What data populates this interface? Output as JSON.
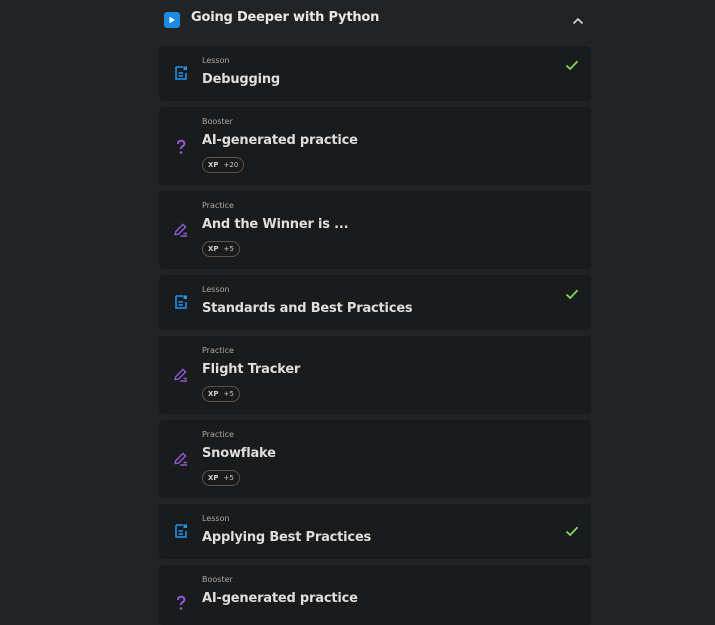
{
  "section": {
    "title": "Going Deeper with Python",
    "play_icon": "play-icon",
    "collapse_icon": "chevron-up-icon"
  },
  "colors": {
    "background": "#222324",
    "card": "#1a1b1c",
    "lesson_icon": "#2196f3",
    "practice_icon": "#8e5bd6",
    "check": "#7ed957"
  },
  "xp_label": "XP",
  "items": [
    {
      "kind": "Lesson",
      "title": "Debugging",
      "icon": "document-icon",
      "completed": true
    },
    {
      "kind": "Booster",
      "title": "AI-generated practice",
      "icon": "question-mark-icon",
      "xp": "+20"
    },
    {
      "kind": "Practice",
      "title": "And the Winner is ...",
      "icon": "pencil-icon",
      "xp": "+5"
    },
    {
      "kind": "Lesson",
      "title": "Standards and Best Practices",
      "icon": "document-icon",
      "completed": true
    },
    {
      "kind": "Practice",
      "title": "Flight Tracker",
      "icon": "pencil-icon",
      "xp": "+5"
    },
    {
      "kind": "Practice",
      "title": "Snowflake",
      "icon": "pencil-icon",
      "xp": "+5"
    },
    {
      "kind": "Lesson",
      "title": "Applying Best Practices",
      "icon": "document-icon",
      "completed": true
    },
    {
      "kind": "Booster",
      "title": "AI-generated practice",
      "icon": "question-mark-icon"
    }
  ]
}
